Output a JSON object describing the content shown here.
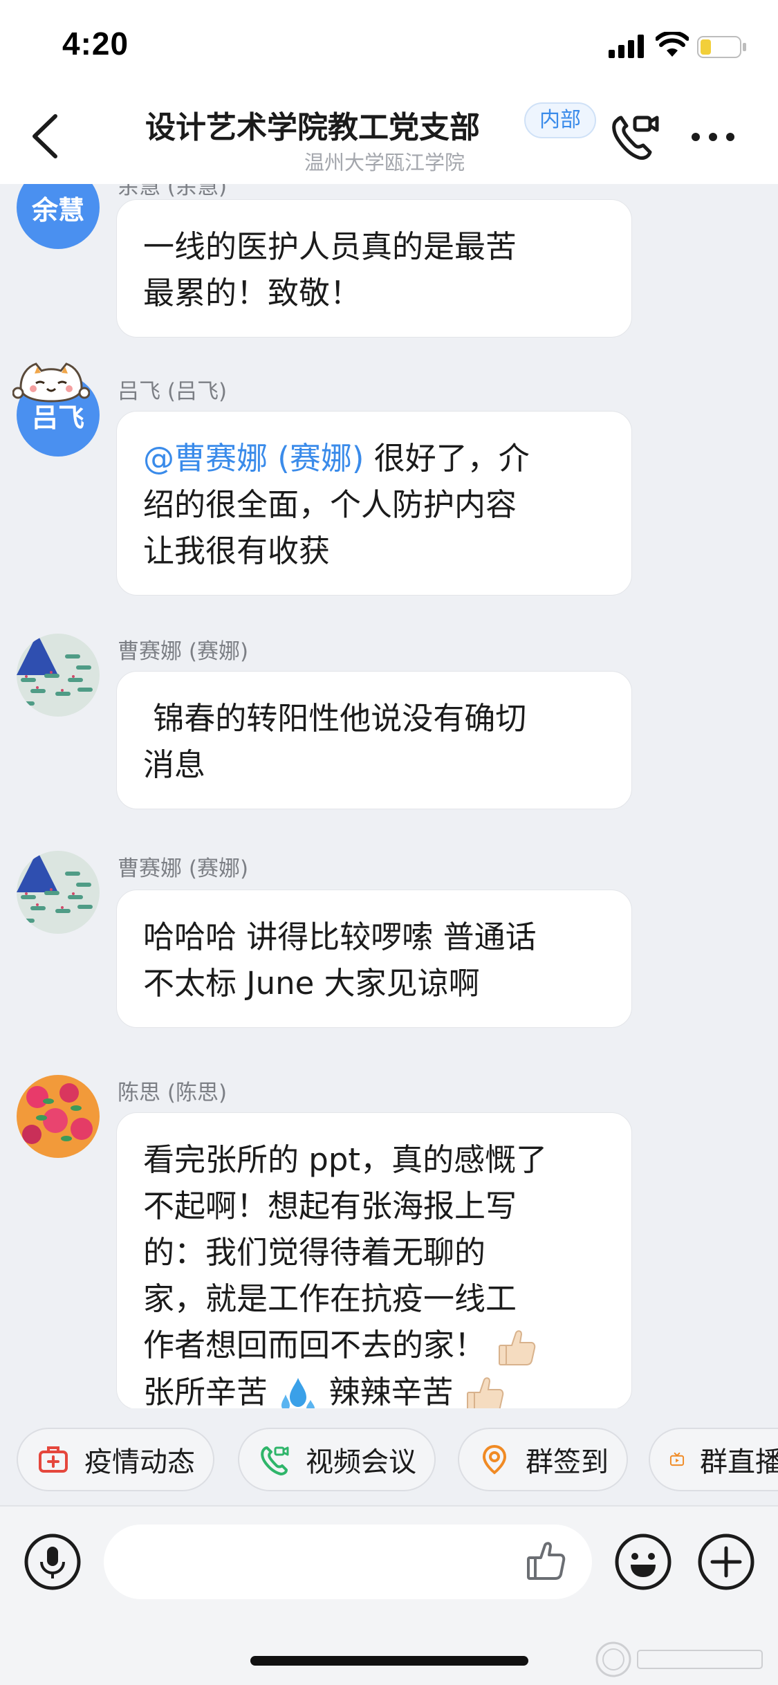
{
  "status_bar": {
    "time": "4:20"
  },
  "header": {
    "title": "设计艺术学院教工党支部",
    "badge": "内部",
    "subtitle": "温州大学瓯江学院"
  },
  "messages": [
    {
      "sender": "余慧 (余慧)",
      "avatar_text": "余慧",
      "lines": [
        "一线的医护人员真的是最苦",
        "最累的！致敬！"
      ]
    },
    {
      "sender": "吕飞 (吕飞)",
      "avatar_text": "吕飞",
      "mention": "@曹赛娜 (赛娜)",
      "lines": [
        " 很好了，介",
        "绍的很全面，个人防护内容",
        "让我很有收获"
      ]
    },
    {
      "sender": "曹赛娜 (赛娜)",
      "lines": [
        " 锦春的转阳性他说没有确切",
        "消息"
      ]
    },
    {
      "sender": "曹赛娜 (赛娜)",
      "lines": [
        "哈哈哈 讲得比较啰嗦 普通话",
        "不太标 June 大家见谅啊"
      ]
    },
    {
      "sender": "陈思 (陈思)",
      "lines": [
        "看完张所的 ppt，真的感慨了",
        "不起啊！想起有张海报上写",
        "的：我们觉得待着无聊的",
        "家，就是工作在抗疫一线工",
        "作者想回而回不去的家！",
        "张所辛苦",
        "辣辣辛苦"
      ]
    }
  ],
  "quick_actions": [
    "疫情动态",
    "视频会议",
    "群签到",
    "群直播"
  ],
  "input": {
    "placeholder": ""
  },
  "colors": {
    "accent": "#3a8bea",
    "chip_red": "#e5473d",
    "chip_green": "#2fb56a",
    "chip_orange": "#f08a24"
  }
}
